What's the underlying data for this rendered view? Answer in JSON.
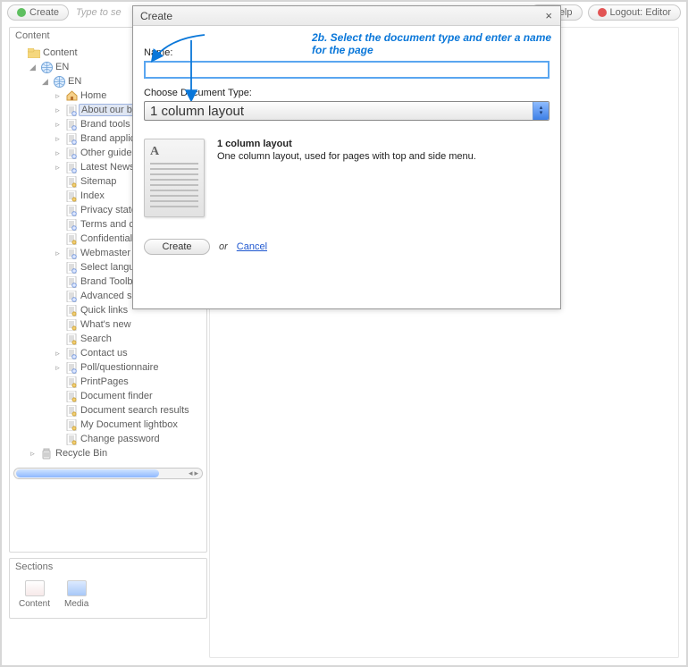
{
  "toolbar": {
    "create": "Create",
    "search_placeholder": "Type to se",
    "help": "Help",
    "logout": "Logout: Editor"
  },
  "panels": {
    "content": "Content",
    "sections": "Sections",
    "sec_content": "Content",
    "sec_media": "Media"
  },
  "tree": {
    "root": "Content",
    "en1": "EN",
    "en2": "EN",
    "items": [
      "Home",
      "About our br",
      "Brand tools",
      "Brand applic",
      "Other guidel",
      "Latest News",
      "Sitemap",
      "Index",
      "Privacy state",
      "Terms and co",
      "Confidentialit",
      "Webmaster",
      "Select langu",
      "Brand Toolbo",
      "Advanced se",
      "Quick links",
      "What's new",
      "Search",
      "Contact us",
      "Poll/questionnaire",
      "PrintPages",
      "Document finder",
      "Document search results",
      "My Document lightbox",
      "Change password"
    ],
    "recycle": "Recycle Bin"
  },
  "dialog": {
    "title": "Create",
    "callout": "2b. Select the document type and enter a name for the page",
    "name_label": "Name:",
    "name_value": "",
    "choose_label": "Choose Document Type:",
    "choose_value": "1 column layout",
    "preview_title": "1 column layout",
    "preview_desc": "One column layout, used for pages with top and side menu.",
    "create_btn": "Create",
    "or": "or",
    "cancel": "Cancel"
  }
}
